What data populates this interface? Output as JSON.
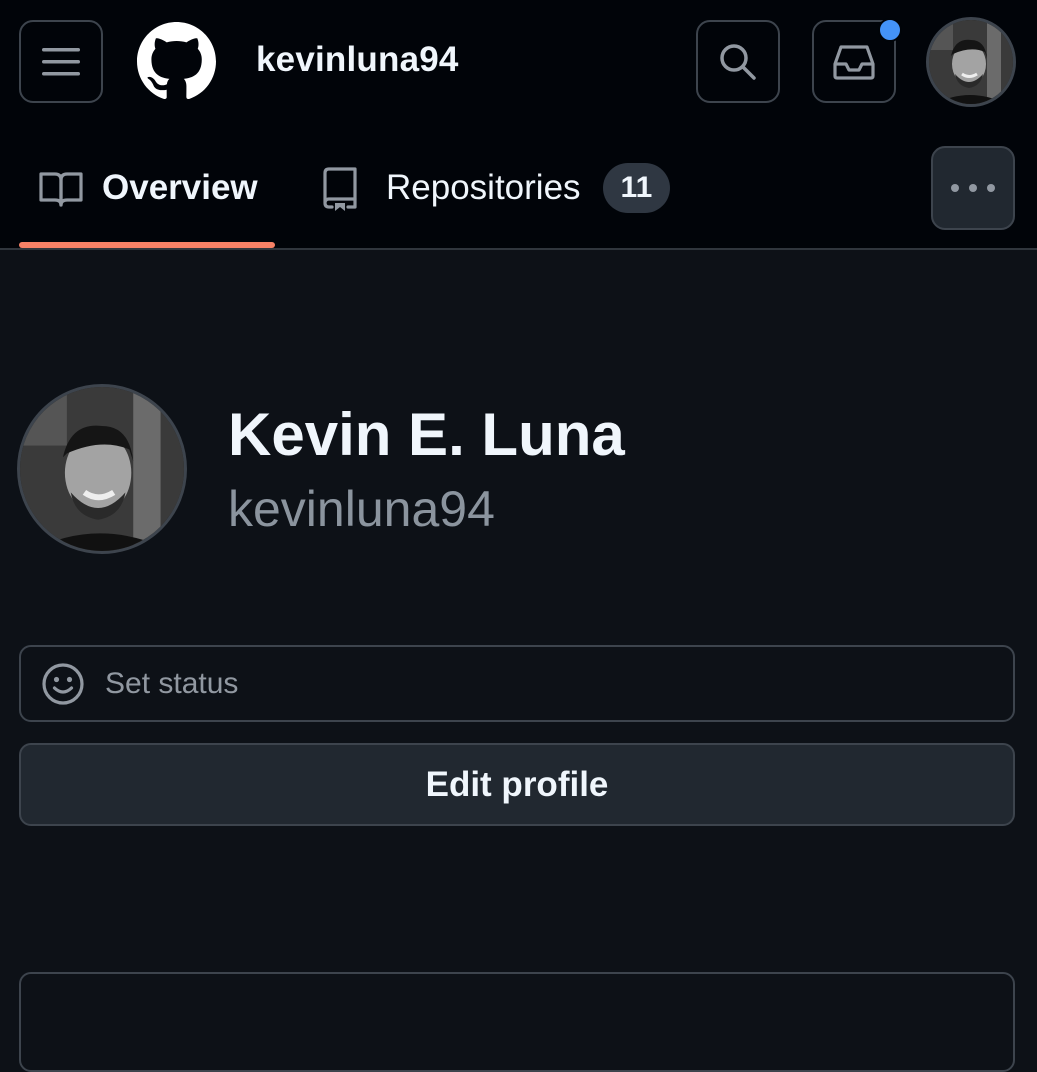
{
  "header": {
    "username": "kevinluna94",
    "icons": {
      "menu": "hamburger-menu-icon",
      "logo": "github-mark-icon",
      "search": "search-icon",
      "inbox": "inbox-icon"
    },
    "has_unread_notifications": true
  },
  "tabs": [
    {
      "label": "Overview",
      "icon": "book-icon",
      "selected": true
    },
    {
      "label": "Repositories",
      "icon": "repo-icon",
      "count": "11",
      "selected": false
    }
  ],
  "profile": {
    "full_name": "Kevin E. Luna",
    "login": "kevinluna94",
    "status_label": "Set status",
    "edit_label": "Edit profile"
  },
  "colors": {
    "background": "#0d1117",
    "header_background": "#010409",
    "tab_underline": "#f78166",
    "notification_dot": "#4493f8",
    "border": "#3d444d",
    "button_background": "#212830"
  }
}
